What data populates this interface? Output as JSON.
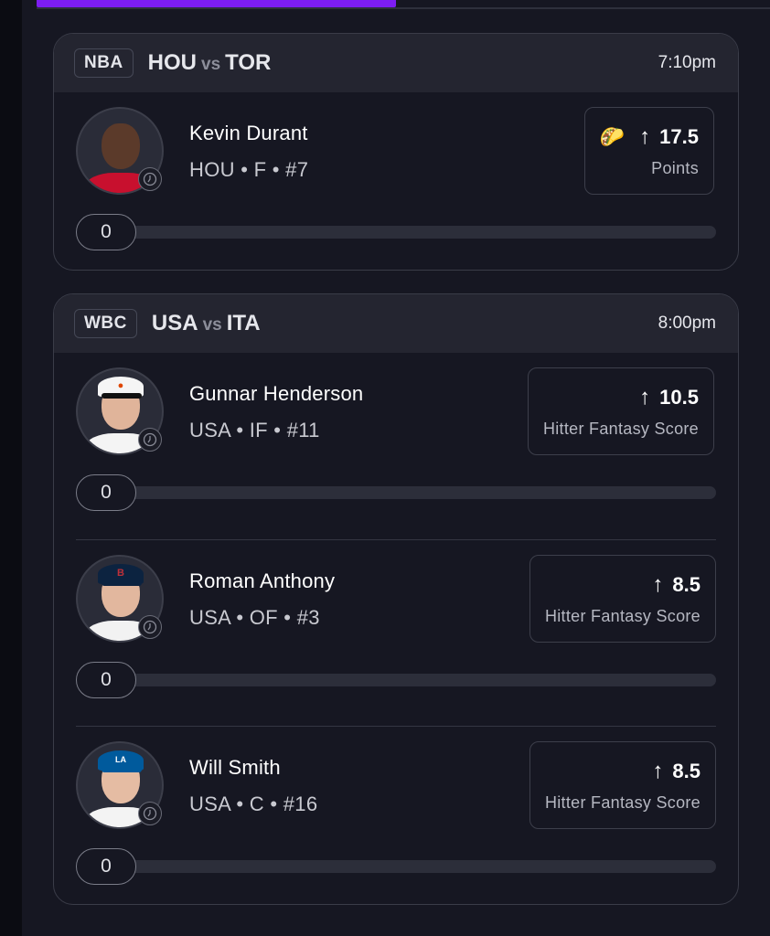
{
  "games": [
    {
      "league": "NBA",
      "home": "HOU",
      "vs": "vs",
      "away": "TOR",
      "time": "7:10pm",
      "players": [
        {
          "name": "Kevin Durant",
          "meta": "HOU • F • #7",
          "line": "17.5",
          "stat": "Points",
          "direction_icon": "arrow-up-icon",
          "boost_icon": "taco-icon",
          "boost_glyph": "🌮",
          "progress_label": "0",
          "progress": 0,
          "headshot": {
            "skin": "#5b3a2a",
            "jersey": "#c8102e",
            "cap": null
          }
        }
      ]
    },
    {
      "league": "WBC",
      "home": "USA",
      "vs": "vs",
      "away": "ITA",
      "time": "8:00pm",
      "players": [
        {
          "name": "Gunnar Henderson",
          "meta": "USA • IF • #11",
          "line": "10.5",
          "stat": "Hitter Fantasy Score",
          "direction_icon": "arrow-up-icon",
          "progress_label": "0",
          "progress": 0,
          "headshot": {
            "skin": "#e0b49a",
            "jersey": "#f4f4f4",
            "cap": "#f5f5f5",
            "cap_logo": "orioles-logo-icon",
            "cap_logo_color": "#df4601"
          }
        },
        {
          "name": "Roman Anthony",
          "meta": "USA • OF • #3",
          "line": "8.5",
          "stat": "Hitter Fantasy Score",
          "direction_icon": "arrow-up-icon",
          "progress_label": "0",
          "progress": 0,
          "headshot": {
            "skin": "#e2b79e",
            "jersey": "#f2f2f2",
            "cap": "#0c2340",
            "cap_logo": "red-sox-logo-icon",
            "cap_logo_color": "#bd3039"
          }
        },
        {
          "name": "Will Smith",
          "meta": "USA • C • #16",
          "line": "8.5",
          "stat": "Hitter Fantasy Score",
          "direction_icon": "arrow-up-icon",
          "progress_label": "0",
          "progress": 0,
          "headshot": {
            "skin": "#e5bca3",
            "jersey": "#f3f3f3",
            "cap": "#005a9c",
            "cap_logo": "dodgers-logo-icon",
            "cap_logo_color": "#ffffff"
          }
        }
      ]
    }
  ],
  "colors": {
    "accent": "#7d1df2",
    "background": "#161722",
    "card_header": "#242530"
  }
}
